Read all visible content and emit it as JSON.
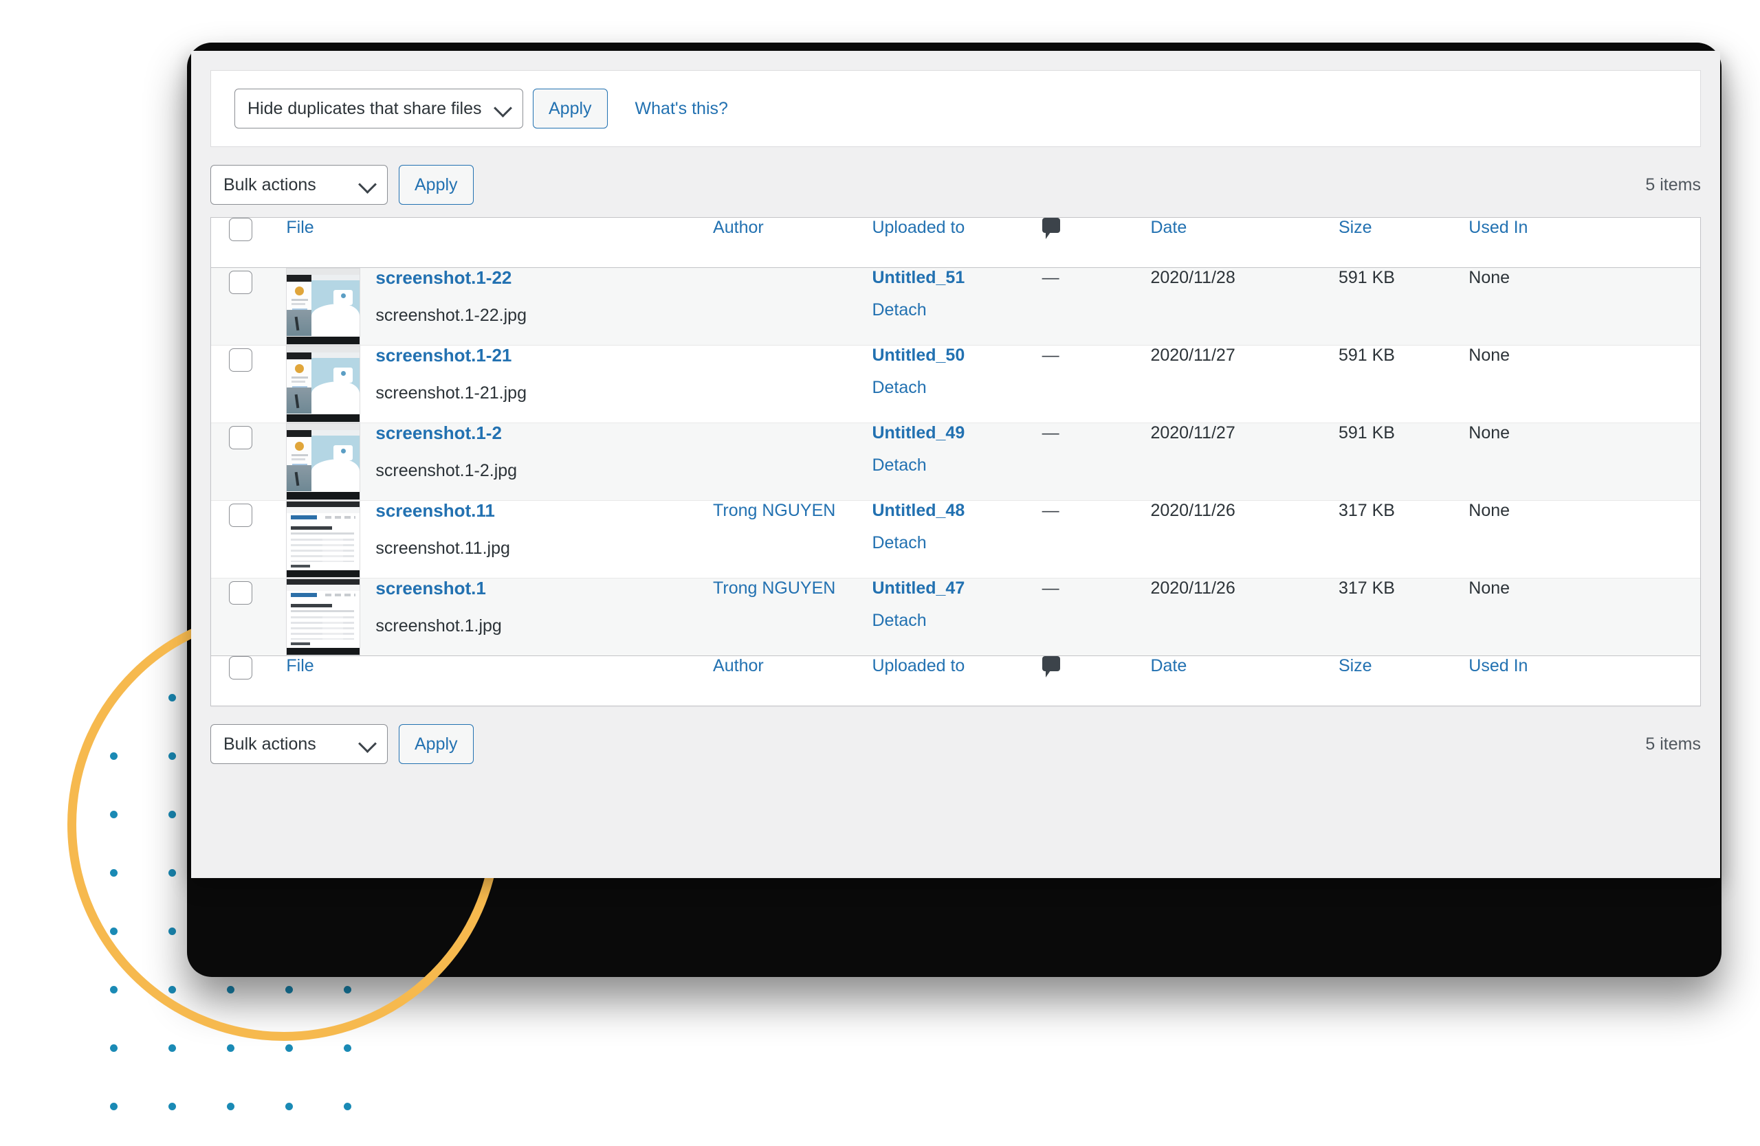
{
  "filter_bar": {
    "select_value": "Hide duplicates that share files",
    "apply_label": "Apply",
    "help_link": "What's this?"
  },
  "tablenav_top": {
    "bulk_select_value": "Bulk actions",
    "apply_label": "Apply",
    "items_count": "5 items"
  },
  "tablenav_bottom": {
    "bulk_select_value": "Bulk actions",
    "apply_label": "Apply",
    "items_count": "5 items"
  },
  "table": {
    "columns": {
      "file": "File",
      "author": "Author",
      "uploaded_to": "Uploaded to",
      "comments_icon": "comment-bubble-icon",
      "date": "Date",
      "size": "Size",
      "used_in": "Used In"
    },
    "rows": [
      {
        "title": "screenshot.1-22",
        "filename": "screenshot.1-22.jpg",
        "thumb": "blue-landing-page",
        "author": "",
        "uploaded_to": "Untitled_51",
        "detach": "Detach",
        "comments": "—",
        "date": "2020/11/28",
        "size": "591 KB",
        "used_in": "None"
      },
      {
        "title": "screenshot.1-21",
        "filename": "screenshot.1-21.jpg",
        "thumb": "blue-landing-page",
        "author": "",
        "uploaded_to": "Untitled_50",
        "detach": "Detach",
        "comments": "—",
        "date": "2020/11/27",
        "size": "591 KB",
        "used_in": "None"
      },
      {
        "title": "screenshot.1-2",
        "filename": "screenshot.1-2.jpg",
        "thumb": "blue-landing-page",
        "author": "",
        "uploaded_to": "Untitled_49",
        "detach": "Detach",
        "comments": "—",
        "date": "2020/11/27",
        "size": "591 KB",
        "used_in": "None"
      },
      {
        "title": "screenshot.11",
        "filename": "screenshot.11.jpg",
        "thumb": "white-receipt-page",
        "author": "Trong NGUYEN",
        "uploaded_to": "Untitled_48",
        "detach": "Detach",
        "comments": "—",
        "date": "2020/11/26",
        "size": "317 KB",
        "used_in": "None"
      },
      {
        "title": "screenshot.1",
        "filename": "screenshot.1.jpg",
        "thumb": "white-receipt-page",
        "author": "Trong NGUYEN",
        "uploaded_to": "Untitled_47",
        "detach": "Detach",
        "comments": "—",
        "date": "2020/11/26",
        "size": "317 KB",
        "used_in": "None"
      }
    ]
  },
  "decor": {
    "circle_color": "#f6b94e",
    "dot_color": "#1a8ab5",
    "card_color": "#0a0a0a",
    "link_color": "#2271b1",
    "panel_bg": "#f0f0f1"
  }
}
